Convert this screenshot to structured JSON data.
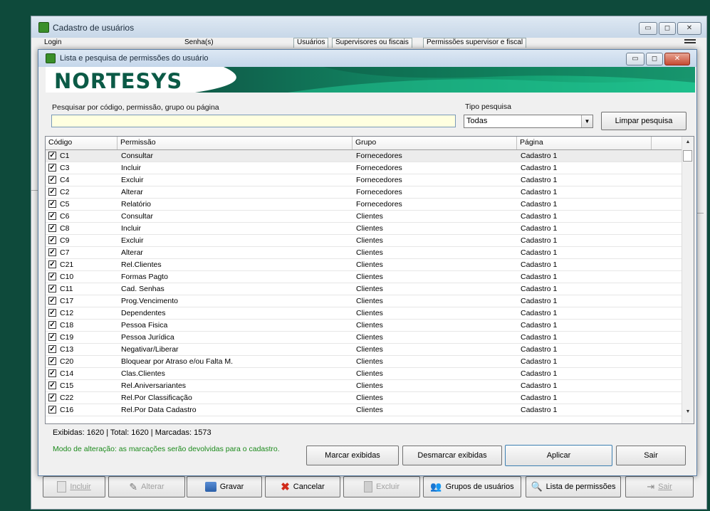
{
  "back_window": {
    "title": "Cadastro de usuários",
    "win_min": "▭",
    "win_max": "◻",
    "win_close": "✕",
    "col_login": "Login",
    "col_senha": "Senha(s)",
    "tabs": [
      "Usuários",
      "Supervisores ou fiscais",
      "Permissões supervisor e fiscal"
    ],
    "toolbar": {
      "incluir": "Incluir",
      "alterar": "Alterar",
      "gravar": "Gravar",
      "cancelar": "Cancelar",
      "excluir": "Excluir",
      "grupos": "Grupos de usuários",
      "lista": "Lista de permissões",
      "sair": "Sair"
    }
  },
  "dialog": {
    "title": "Lista e pesquisa de permissões do usuário",
    "brand": "NORTESYS",
    "search_label": "Pesquisar por código, permissão, grupo ou página",
    "search_value": "",
    "tipo_label": "Tipo pesquisa",
    "tipo_value": "Todas",
    "limpar": "Limpar pesquisa",
    "columns": [
      "Código",
      "Permissão",
      "Grupo",
      "Página"
    ],
    "rows": [
      {
        "checked": true,
        "codigo": "C1",
        "permissao": "Consultar",
        "grupo": "Fornecedores",
        "pagina": "Cadastro 1"
      },
      {
        "checked": true,
        "codigo": "C3",
        "permissao": "Incluir",
        "grupo": "Fornecedores",
        "pagina": "Cadastro 1"
      },
      {
        "checked": true,
        "codigo": "C4",
        "permissao": "Excluir",
        "grupo": "Fornecedores",
        "pagina": "Cadastro 1"
      },
      {
        "checked": true,
        "codigo": "C2",
        "permissao": "Alterar",
        "grupo": "Fornecedores",
        "pagina": "Cadastro 1"
      },
      {
        "checked": true,
        "codigo": "C5",
        "permissao": "Relatório",
        "grupo": "Fornecedores",
        "pagina": "Cadastro 1"
      },
      {
        "checked": true,
        "codigo": "C6",
        "permissao": "Consultar",
        "grupo": "Clientes",
        "pagina": "Cadastro 1"
      },
      {
        "checked": true,
        "codigo": "C8",
        "permissao": "Incluir",
        "grupo": "Clientes",
        "pagina": "Cadastro 1"
      },
      {
        "checked": true,
        "codigo": "C9",
        "permissao": "Excluir",
        "grupo": "Clientes",
        "pagina": "Cadastro 1"
      },
      {
        "checked": true,
        "codigo": "C7",
        "permissao": "Alterar",
        "grupo": "Clientes",
        "pagina": "Cadastro 1"
      },
      {
        "checked": true,
        "codigo": "C21",
        "permissao": "Rel.Clientes",
        "grupo": "Clientes",
        "pagina": "Cadastro 1"
      },
      {
        "checked": true,
        "codigo": "C10",
        "permissao": "Formas Pagto",
        "grupo": "Clientes",
        "pagina": "Cadastro 1"
      },
      {
        "checked": true,
        "codigo": "C11",
        "permissao": "Cad. Senhas",
        "grupo": "Clientes",
        "pagina": "Cadastro 1"
      },
      {
        "checked": true,
        "codigo": "C17",
        "permissao": "Prog.Vencimento",
        "grupo": "Clientes",
        "pagina": "Cadastro 1"
      },
      {
        "checked": true,
        "codigo": "C12",
        "permissao": "Dependentes",
        "grupo": "Clientes",
        "pagina": "Cadastro 1"
      },
      {
        "checked": true,
        "codigo": "C18",
        "permissao": "Pessoa Fisica",
        "grupo": "Clientes",
        "pagina": "Cadastro 1"
      },
      {
        "checked": true,
        "codigo": "C19",
        "permissao": "Pessoa Jurídica",
        "grupo": "Clientes",
        "pagina": "Cadastro 1"
      },
      {
        "checked": true,
        "codigo": "C13",
        "permissao": "Negativar/Liberar",
        "grupo": "Clientes",
        "pagina": "Cadastro 1"
      },
      {
        "checked": true,
        "codigo": "C20",
        "permissao": "Bloquear por Atraso e/ou Falta M.",
        "grupo": "Clientes",
        "pagina": "Cadastro 1"
      },
      {
        "checked": true,
        "codigo": "C14",
        "permissao": "Clas.Clientes",
        "grupo": "Clientes",
        "pagina": "Cadastro 1"
      },
      {
        "checked": true,
        "codigo": "C15",
        "permissao": "Rel.Aniversariantes",
        "grupo": "Clientes",
        "pagina": "Cadastro 1"
      },
      {
        "checked": true,
        "codigo": "C22",
        "permissao": "Rel.Por Classificação",
        "grupo": "Clientes",
        "pagina": "Cadastro 1"
      },
      {
        "checked": true,
        "codigo": "C16",
        "permissao": "Rel.Por Data Cadastro",
        "grupo": "Clientes",
        "pagina": "Cadastro 1"
      }
    ],
    "status": "Exibidas: 1620  |  Total: 1620  |  Marcadas: 1573",
    "mode_text": "Modo de alteração: as marcações serão devolvidas para o cadastro.",
    "buttons": {
      "marcar": "Marcar exibidas",
      "desmarcar": "Desmarcar exibidas",
      "aplicar": "Aplicar",
      "sair": "Sair"
    }
  }
}
